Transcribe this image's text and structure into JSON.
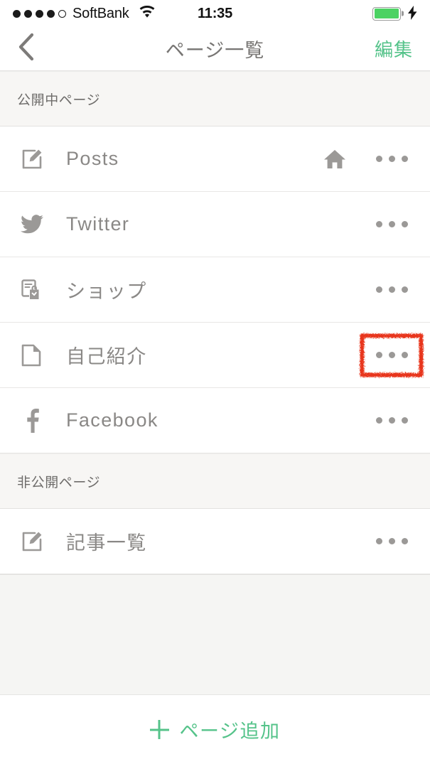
{
  "status_bar": {
    "signal_dots_filled": 4,
    "signal_dots_total": 5,
    "carrier": "SoftBank",
    "wifi_icon": "wifi-icon",
    "time": "11:35",
    "battery_icon": "battery-icon",
    "battery_color": "#4cd263",
    "battery_level_percent": 100,
    "charging_icon": "lightning-bolt-icon"
  },
  "nav_bar": {
    "back_icon": "chevron-left-icon",
    "title": "ページ一覧",
    "action_label": "編集",
    "accent_color": "#55c38a"
  },
  "sections": [
    {
      "header": "公開中ページ",
      "rows": [
        {
          "icon": "edit-square-icon",
          "label": "Posts",
          "home_badge": true,
          "home_icon": "home-icon",
          "more_icon": "more-horizontal-icon",
          "annotated": false
        },
        {
          "icon": "twitter-bird-icon",
          "label": "Twitter",
          "home_badge": false,
          "more_icon": "more-horizontal-icon",
          "annotated": false
        },
        {
          "icon": "shop-bag-icon",
          "label": "ショップ",
          "home_badge": false,
          "more_icon": "more-horizontal-icon",
          "annotated": false
        },
        {
          "icon": "document-page-icon",
          "label": "自己紹介",
          "home_badge": false,
          "more_icon": "more-horizontal-icon",
          "annotated": true
        },
        {
          "icon": "facebook-f-icon",
          "label": "Facebook",
          "home_badge": false,
          "more_icon": "more-horizontal-icon",
          "annotated": false
        }
      ]
    },
    {
      "header": "非公開ページ",
      "rows": [
        {
          "icon": "edit-square-icon",
          "label": "記事一覧",
          "home_badge": false,
          "more_icon": "more-horizontal-icon",
          "annotated": false
        }
      ]
    }
  ],
  "add_bar": {
    "plus_icon": "plus-icon",
    "label": "ページ追加",
    "accent_color": "#55c38a"
  },
  "annotation": {
    "color": "#e8341b",
    "target": "more-button-自己紹介"
  }
}
